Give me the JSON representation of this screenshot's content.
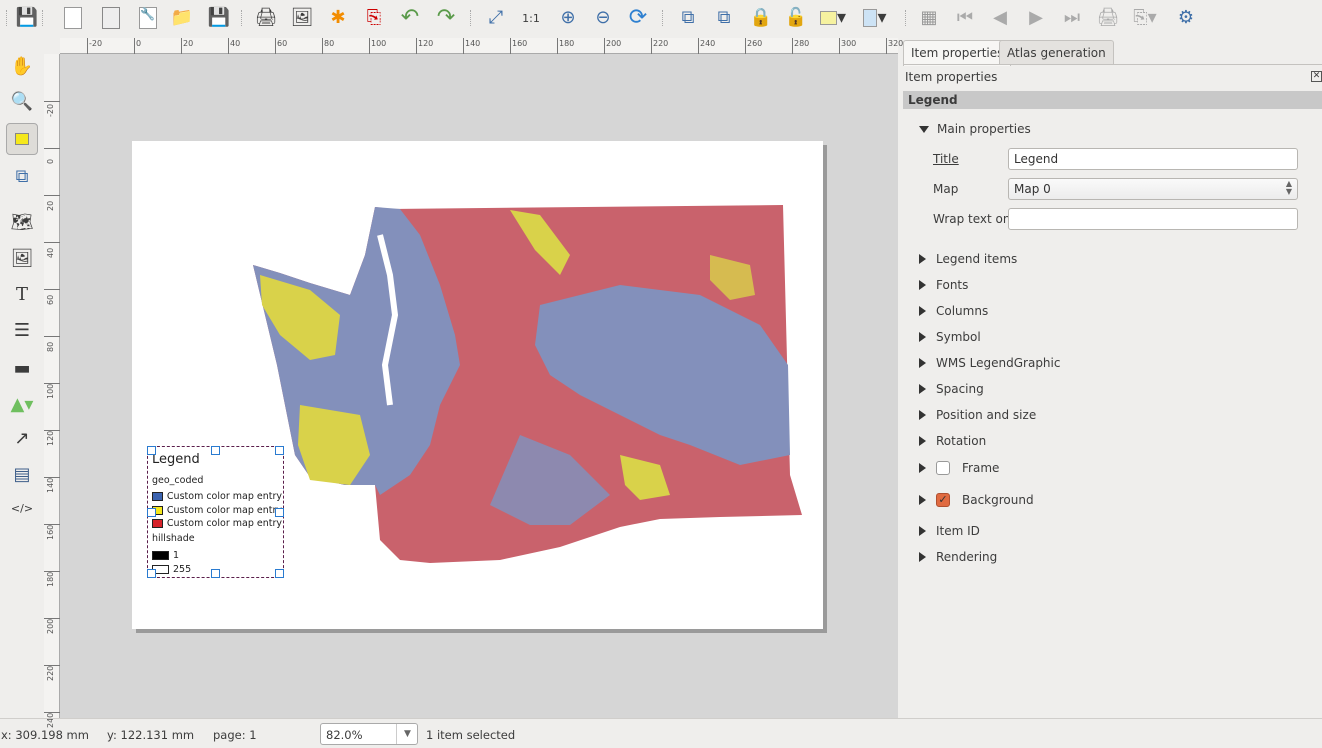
{
  "toolbar": {
    "icons": [
      "save-icon",
      "new-composer-icon",
      "duplicate-composer-icon",
      "composer-manager-icon",
      "open-template-icon",
      "save-template-icon",
      "print-icon",
      "export-image-icon",
      "export-svg-icon",
      "export-pdf-icon",
      "undo-icon",
      "redo-icon",
      "zoom-full-icon",
      "zoom-actual-icon",
      "zoom-in-icon",
      "zoom-out-icon",
      "refresh-icon",
      "group-icon",
      "ungroup-icon",
      "lock-icon",
      "unlock-icon",
      "raise-icon",
      "align-icon",
      "atlas-preview-icon",
      "first-feature-icon",
      "previous-feature-icon",
      "next-feature-icon",
      "last-feature-icon",
      "print-atlas-icon",
      "export-atlas-icon",
      "atlas-settings-icon"
    ]
  },
  "toolbox": {
    "icons": [
      "pan-icon",
      "zoom-tool-icon",
      "select-move-icon",
      "move-content-icon",
      "add-map-icon",
      "add-image-icon",
      "add-label-icon",
      "add-legend-icon",
      "add-scalebar-icon",
      "add-shape-icon",
      "add-arrow-icon",
      "add-table-icon",
      "add-html-icon"
    ]
  },
  "rulers": {
    "horizontal": [
      "-20",
      "0",
      "20",
      "40",
      "60",
      "80",
      "100",
      "120",
      "140",
      "160",
      "180",
      "200",
      "220",
      "240",
      "260",
      "280",
      "300",
      "320"
    ],
    "vertical": [
      "-20",
      "0",
      "20",
      "40",
      "60",
      "80",
      "100",
      "120",
      "140",
      "160",
      "180",
      "200",
      "220",
      "240"
    ]
  },
  "legend": {
    "title": "Legend",
    "groups": [
      {
        "name": "geo_coded",
        "items": [
          {
            "label": "Custom color map entry",
            "color": "#3b63b0"
          },
          {
            "label": "Custom color map entry",
            "color": "#f5e81c"
          },
          {
            "label": "Custom color map entry",
            "color": "#d7232a"
          }
        ]
      },
      {
        "name": "hillshade",
        "items": [
          {
            "label": "1",
            "color": "#000000"
          },
          {
            "label": "255",
            "color": "#ffffff"
          }
        ]
      }
    ]
  },
  "panel": {
    "tabs": [
      "Item properties",
      "Atlas generation"
    ],
    "header": "Item properties",
    "item_type": "Legend",
    "main_section": "Main properties",
    "title_label": "Title",
    "title_value": "Legend",
    "map_label": "Map",
    "map_value": "Map 0",
    "wrap_label": "Wrap text on",
    "wrap_value": "",
    "sections": [
      "Legend items",
      "Fonts",
      "Columns",
      "Symbol",
      "WMS LegendGraphic",
      "Spacing",
      "Position and size",
      "Rotation"
    ],
    "frame_label": "Frame",
    "frame_checked": false,
    "background_label": "Background",
    "background_checked": true,
    "sections_after": [
      "Item ID",
      "Rendering"
    ]
  },
  "status": {
    "x": "x: 309.198 mm",
    "y": "y: 122.131 mm",
    "page": "page: 1",
    "zoom": "82.0%",
    "selection": "1 item selected"
  }
}
